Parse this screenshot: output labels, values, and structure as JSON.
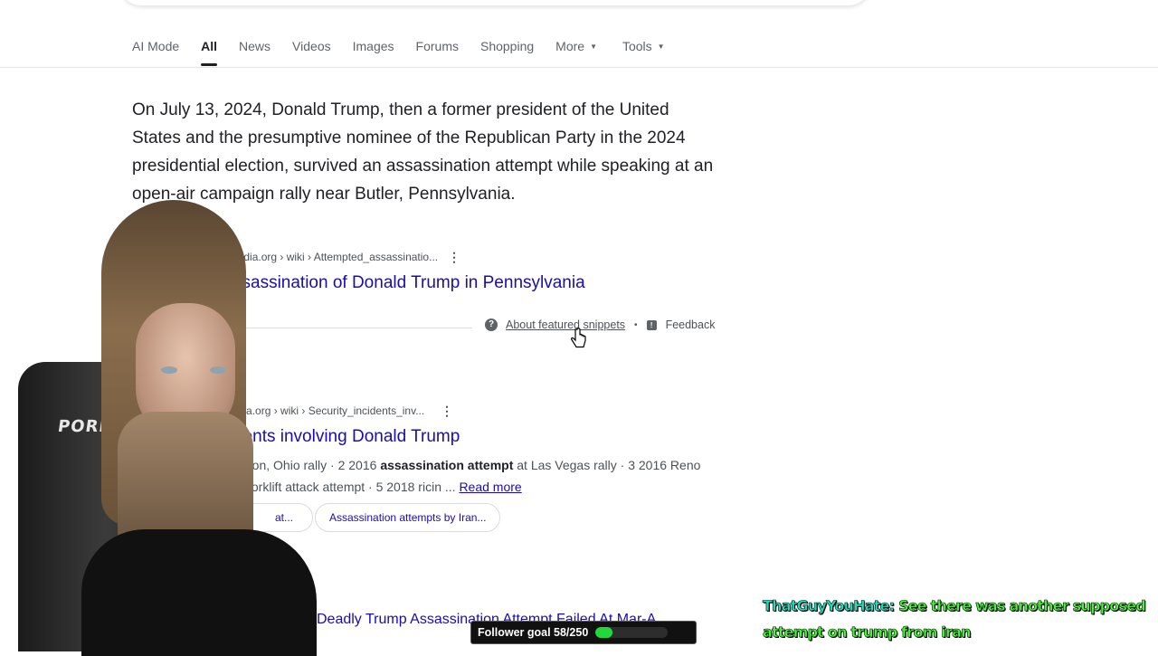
{
  "tabs": [
    {
      "label": "AI Mode"
    },
    {
      "label": "All"
    },
    {
      "label": "News"
    },
    {
      "label": "Videos"
    },
    {
      "label": "Images"
    },
    {
      "label": "Forums"
    },
    {
      "label": "Shopping"
    },
    {
      "label": "More"
    },
    {
      "label": "Tools"
    }
  ],
  "featured_snippet": {
    "text": "On July 13, 2024, Donald Trump, then a former president of the United States and the presumptive nominee of the Republican Party in the 2024 presidential election, survived an assassination attempt while speaking at an open-air campaign rally near Butler, Pennsylvania.",
    "url": "pedia.org › wiki › Attempted_assassinatio...",
    "title": "ssassination of Donald Trump in Pennsylvania",
    "about_label": "About featured snippets",
    "feedback_label": "Feedback"
  },
  "result2": {
    "url": "edia.org › wiki › Security_incidents_inv...",
    "title": "dents involving Donald Trump",
    "desc_line1_a": "ayton, Ohio rally · 2 2016 ",
    "desc_line1_bold": "assassination attempt",
    "desc_line1_b": " at Las Vegas rally · 3 2016 Reno",
    "desc_line2": "forklift attack attempt · 5 2018 ricin ... ",
    "read_more": "Read more",
    "chip1": "at...",
    "chip2": "Assassination attempts by Iran..."
  },
  "result3": {
    "title": "Deadly Trump Assassination Attempt Failed At Mar-A..."
  },
  "overlay": {
    "chair_text": "PORIYA",
    "follower_goal_label": "Follower goal 58/250",
    "follower_progress": 0.232,
    "chat_user": "ThatGuyYouHate:",
    "chat_message": "See there was another supposed attempt on trump from iran"
  },
  "icons": {
    "menu_dots": "⋮",
    "question": "?",
    "feedback": "!",
    "caret": "▼"
  }
}
